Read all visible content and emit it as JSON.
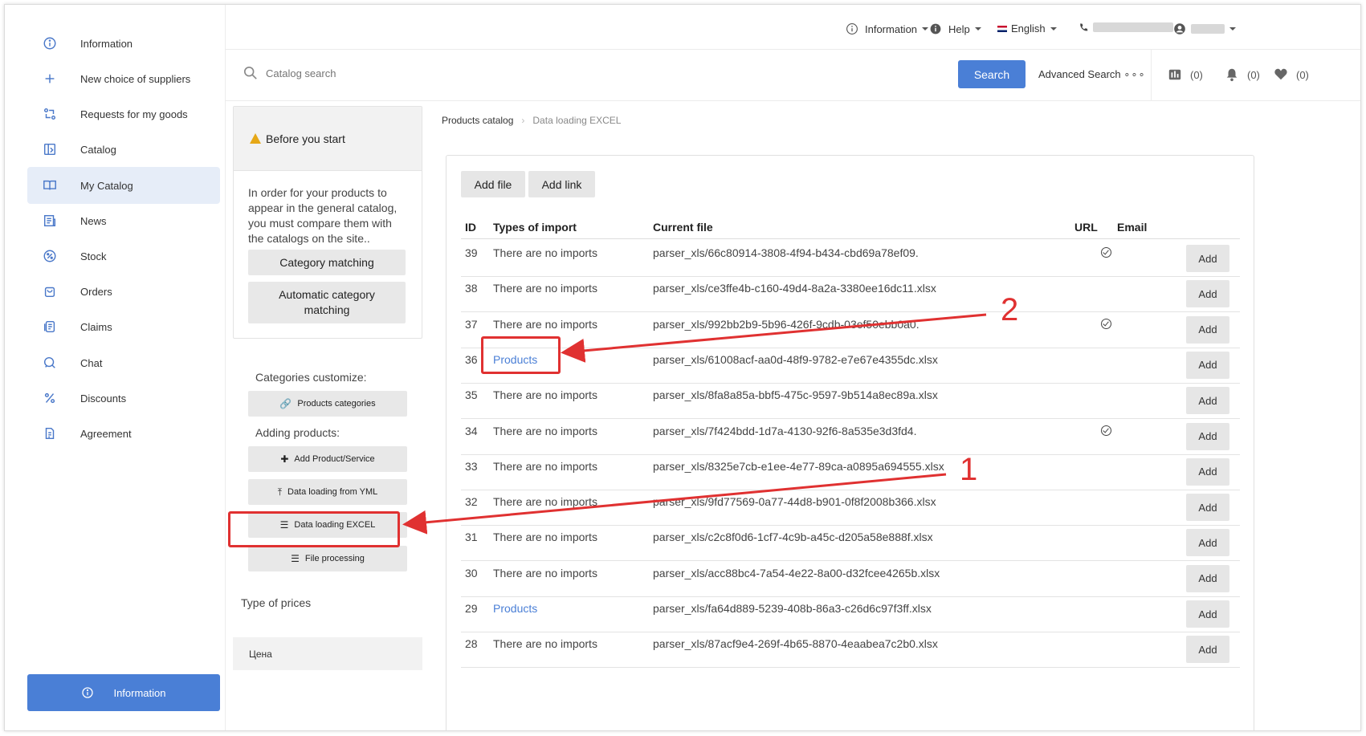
{
  "sidebar": {
    "items": [
      {
        "label": "Information",
        "icon": "info-icon"
      },
      {
        "label": "New choice of suppliers",
        "icon": "plus-icon"
      },
      {
        "label": "Requests for my goods",
        "icon": "exchange-icon"
      },
      {
        "label": "Catalog",
        "icon": "catalog-icon"
      },
      {
        "label": "My Catalog",
        "icon": "book-icon"
      },
      {
        "label": "News",
        "icon": "news-icon"
      },
      {
        "label": "Stock",
        "icon": "percent-circle-icon"
      },
      {
        "label": "Orders",
        "icon": "bag-icon"
      },
      {
        "label": "Claims",
        "icon": "claims-icon"
      },
      {
        "label": "Chat",
        "icon": "chat-icon"
      },
      {
        "label": "Discounts",
        "icon": "percent-icon"
      },
      {
        "label": "Agreement",
        "icon": "document-icon"
      }
    ],
    "bottom_button": "Information"
  },
  "topbar": {
    "information": "Information",
    "help": "Help",
    "language": "English"
  },
  "search": {
    "placeholder": "Catalog search",
    "button": "Search",
    "advanced": "Advanced Search",
    "compare_count": "(0)",
    "notify_count": "(0)",
    "fav_count": "(0)"
  },
  "left_panel": {
    "before_title": "Before you start",
    "before_text": "In order for your products to appear in the general catalog, you must compare them with the catalogs on the site..",
    "category_matching": "Category matching",
    "auto_matching": "Automatic category matching",
    "categories_customize": "Categories customize:",
    "products_categories": "Products categories",
    "adding_products": "Adding products:",
    "add_product": "Add Product/Service",
    "yml": "Data loading from YML",
    "excel": "Data loading EXCEL",
    "file_processing": "File processing",
    "type_of_prices": "Type of prices",
    "price_name": "Цена"
  },
  "breadcrumb": {
    "root": "Products catalog",
    "current": "Data loading EXCEL"
  },
  "toolbar": {
    "add_file": "Add file",
    "add_link": "Add link"
  },
  "table": {
    "headers": {
      "id": "ID",
      "type": "Types of import",
      "file": "Current file",
      "url": "URL",
      "email": "Email"
    },
    "add_label": "Add",
    "rows": [
      {
        "id": "39",
        "type": "There are no imports",
        "file": "parser_xls/66c80914-3808-4f94-b434-cbd69a78ef09.",
        "url": true,
        "link": false
      },
      {
        "id": "38",
        "type": "There are no imports",
        "file": "parser_xls/ce3ffe4b-c160-49d4-8a2a-3380ee16dc11.xlsx",
        "url": false,
        "link": false
      },
      {
        "id": "37",
        "type": "There are no imports",
        "file": "parser_xls/992bb2b9-5b96-426f-9cdb-03ef50ebb0a0.",
        "url": true,
        "link": false
      },
      {
        "id": "36",
        "type": "Products",
        "file": "parser_xls/61008acf-aa0d-48f9-9782-e7e67e4355dc.xlsx",
        "url": false,
        "link": true
      },
      {
        "id": "35",
        "type": "There are no imports",
        "file": "parser_xls/8fa8a85a-bbf5-475c-9597-9b514a8ec89a.xlsx",
        "url": false,
        "link": false
      },
      {
        "id": "34",
        "type": "There are no imports",
        "file": "parser_xls/7f424bdd-1d7a-4130-92f6-8a535e3d3fd4.",
        "url": true,
        "link": false
      },
      {
        "id": "33",
        "type": "There are no imports",
        "file": "parser_xls/8325e7cb-e1ee-4e77-89ca-a0895a694555.xlsx",
        "url": false,
        "link": false
      },
      {
        "id": "32",
        "type": "There are no imports",
        "file": "parser_xls/9fd77569-0a77-44d8-b901-0f8f2008b366.xlsx",
        "url": false,
        "link": false
      },
      {
        "id": "31",
        "type": "There are no imports",
        "file": "parser_xls/c2c8f0d6-1cf7-4c9b-a45c-d205a58e888f.xlsx",
        "url": false,
        "link": false
      },
      {
        "id": "30",
        "type": "There are no imports",
        "file": "parser_xls/acc88bc4-7a54-4e22-8a00-d32fcee4265b.xlsx",
        "url": false,
        "link": false
      },
      {
        "id": "29",
        "type": "Products",
        "file": "parser_xls/fa64d889-5239-408b-86a3-c26d6c97f3ff.xlsx",
        "url": false,
        "link": true
      },
      {
        "id": "28",
        "type": "There are no imports",
        "file": "parser_xls/87acf9e4-269f-4b65-8870-4eaabea7c2b0.xlsx",
        "url": false,
        "link": false
      }
    ]
  },
  "annotations": {
    "one": "1",
    "two": "2",
    "color": "#e03131"
  },
  "colors": {
    "accent": "#4a7fd6",
    "active_bg": "#e6edf8"
  }
}
